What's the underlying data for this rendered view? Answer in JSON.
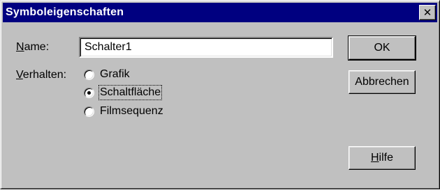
{
  "dialog": {
    "title": "Symboleigenschaften",
    "close_glyph": "✕"
  },
  "form": {
    "name_label_mnemonic": "N",
    "name_label_rest": "ame:",
    "name_value": "Schalter1",
    "behavior_label_mnemonic": "V",
    "behavior_label_rest": "erhalten:",
    "options": [
      {
        "label": "Grafik",
        "checked": false
      },
      {
        "label": "Schaltfläche",
        "checked": true
      },
      {
        "label": "Filmsequenz",
        "checked": false
      }
    ]
  },
  "buttons": {
    "ok_label": "OK",
    "cancel_label": "Abbrechen",
    "help_mnemonic": "H",
    "help_rest": "ilfe"
  },
  "colors": {
    "titlebar": "#000080",
    "face": "#c0c0c0"
  }
}
